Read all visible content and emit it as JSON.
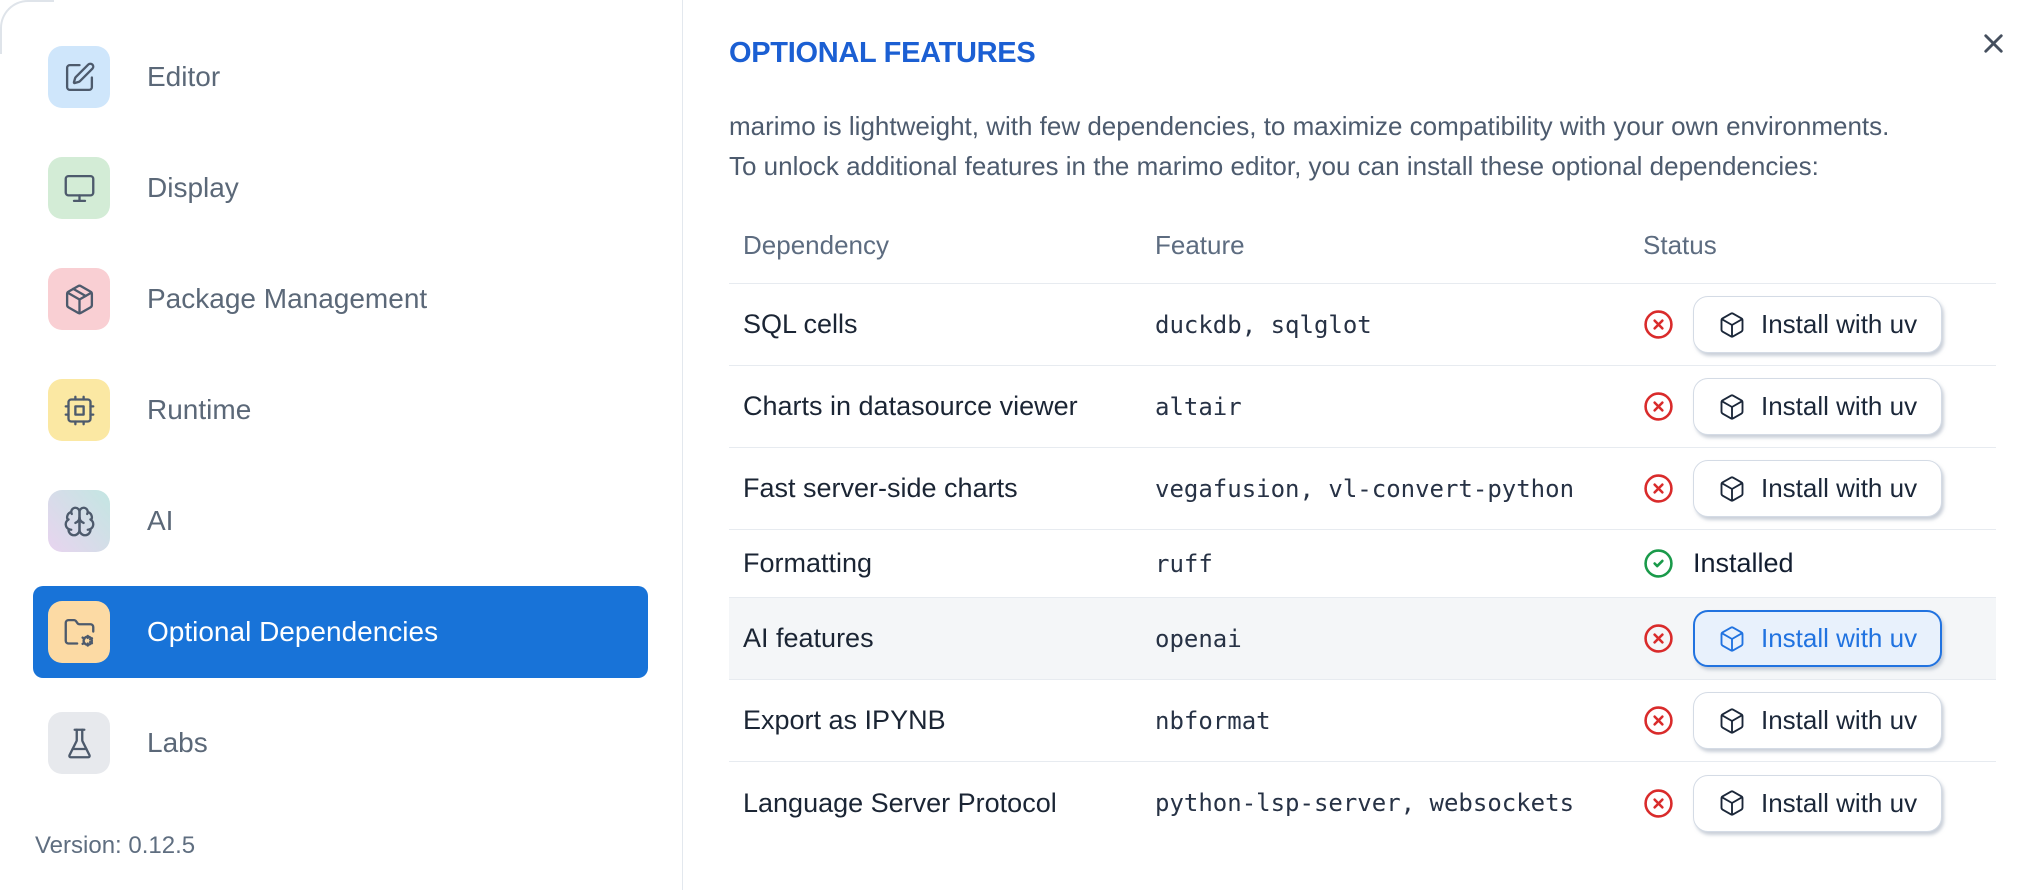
{
  "colors": {
    "accent_blue": "#1873d8",
    "title_blue": "#1b5fd3",
    "status_red": "#d92b2b",
    "status_green": "#1a9a4a",
    "focused_button_blue": "#2173e0"
  },
  "sidebar": {
    "items": [
      {
        "label": "Editor",
        "icon": "square-pen",
        "icon_bg": "#cfe6fb"
      },
      {
        "label": "Display",
        "icon": "monitor",
        "icon_bg": "#d3ecd6"
      },
      {
        "label": "Package Management",
        "icon": "package",
        "icon_bg": "#f9cfd3"
      },
      {
        "label": "Runtime",
        "icon": "cpu",
        "icon_bg": "#fbe8a3"
      },
      {
        "label": "AI",
        "icon": "brain",
        "icon_bg": "linear-gradient(50deg, #e8d4ef 0%, #c3e6e2 100%)"
      },
      {
        "label": "Optional Dependencies",
        "icon": "folder-cog",
        "icon_bg": "#fcdaa4",
        "selected": true
      },
      {
        "label": "Labs",
        "icon": "flask",
        "icon_bg": "#e7e9ed"
      }
    ],
    "version": "Version: 0.12.5"
  },
  "panel": {
    "title": "OPTIONAL FEATURES",
    "description_lines": [
      "marimo is lightweight, with few dependencies, to maximize compatibility with your own environments.",
      "To unlock additional features in the marimo editor, you can install these optional dependencies:"
    ]
  },
  "table": {
    "headers": [
      "Dependency",
      "Feature",
      "Status"
    ],
    "rows": [
      {
        "dependency": "SQL cells",
        "feature": "duckdb, sqlglot",
        "installed": false,
        "button": "Install with uv"
      },
      {
        "dependency": "Charts in datasource viewer",
        "feature": "altair",
        "installed": false,
        "button": "Install with uv"
      },
      {
        "dependency": "Fast server-side charts",
        "feature": "vegafusion, vl-convert-python",
        "installed": false,
        "button": "Install with uv"
      },
      {
        "dependency": "Formatting",
        "feature": "ruff",
        "installed": true,
        "status_text": "Installed"
      },
      {
        "dependency": "AI features",
        "feature": "openai",
        "installed": false,
        "button": "Install with uv",
        "highlighted": true,
        "button_focused": true
      },
      {
        "dependency": "Export as IPYNB",
        "feature": "nbformat",
        "installed": false,
        "button": "Install with uv"
      },
      {
        "dependency": "Language Server Protocol",
        "feature": "python-lsp-server, websockets",
        "installed": false,
        "button": "Install with uv"
      }
    ]
  }
}
